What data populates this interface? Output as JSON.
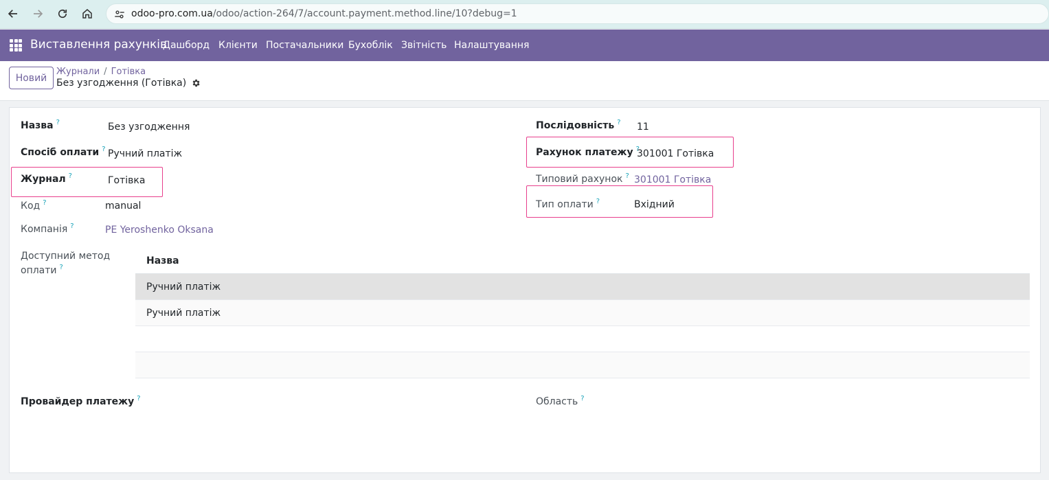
{
  "browser": {
    "url_host": "odoo-pro.com.ua",
    "url_path": "/odoo/action-264/7/account.payment.method.line/10?debug=1"
  },
  "topnav": {
    "app_title": "Виставлення рахунків",
    "menu": [
      "Дашборд",
      "Клієнти",
      "Постачальники",
      "Бухоблік",
      "Звітність",
      "Налаштування"
    ]
  },
  "control": {
    "new_label": "Новий",
    "breadcrumb": [
      "Журнали",
      "Готівка"
    ],
    "record_title": "Без узгодження (Готівка)"
  },
  "form": {
    "help_mark": "?",
    "name": {
      "label": "Назва",
      "value": "Без узгодження"
    },
    "payment_method": {
      "label": "Спосіб оплати",
      "value": "Ручний платіж"
    },
    "journal": {
      "label": "Журнал",
      "value": "Готівка"
    },
    "code": {
      "label": "Код",
      "value": "manual"
    },
    "company": {
      "label": "Компанія",
      "value": "PE Yeroshenko Oksana"
    },
    "sequence": {
      "label": "Послідовність",
      "value": "11"
    },
    "payment_account": {
      "label": "Рахунок платежу",
      "value": "301001 Готівка"
    },
    "default_account": {
      "label": "Типовий рахунок",
      "value": "301001 Готівка"
    },
    "payment_type": {
      "label": "Тип оплати",
      "value": "Вхідний"
    },
    "available_method": {
      "label_line1": "Доступний метод",
      "label_line2": "оплати",
      "column": "Назва",
      "rows": [
        "Ручний платіж",
        "Ручний платіж",
        "",
        ""
      ]
    },
    "provider": {
      "label": "Провайдер платежу"
    },
    "area": {
      "label": "Область"
    }
  },
  "colors": {
    "brand": "#71639e",
    "highlight": "#e83e8c",
    "help": "#17a2b8"
  }
}
